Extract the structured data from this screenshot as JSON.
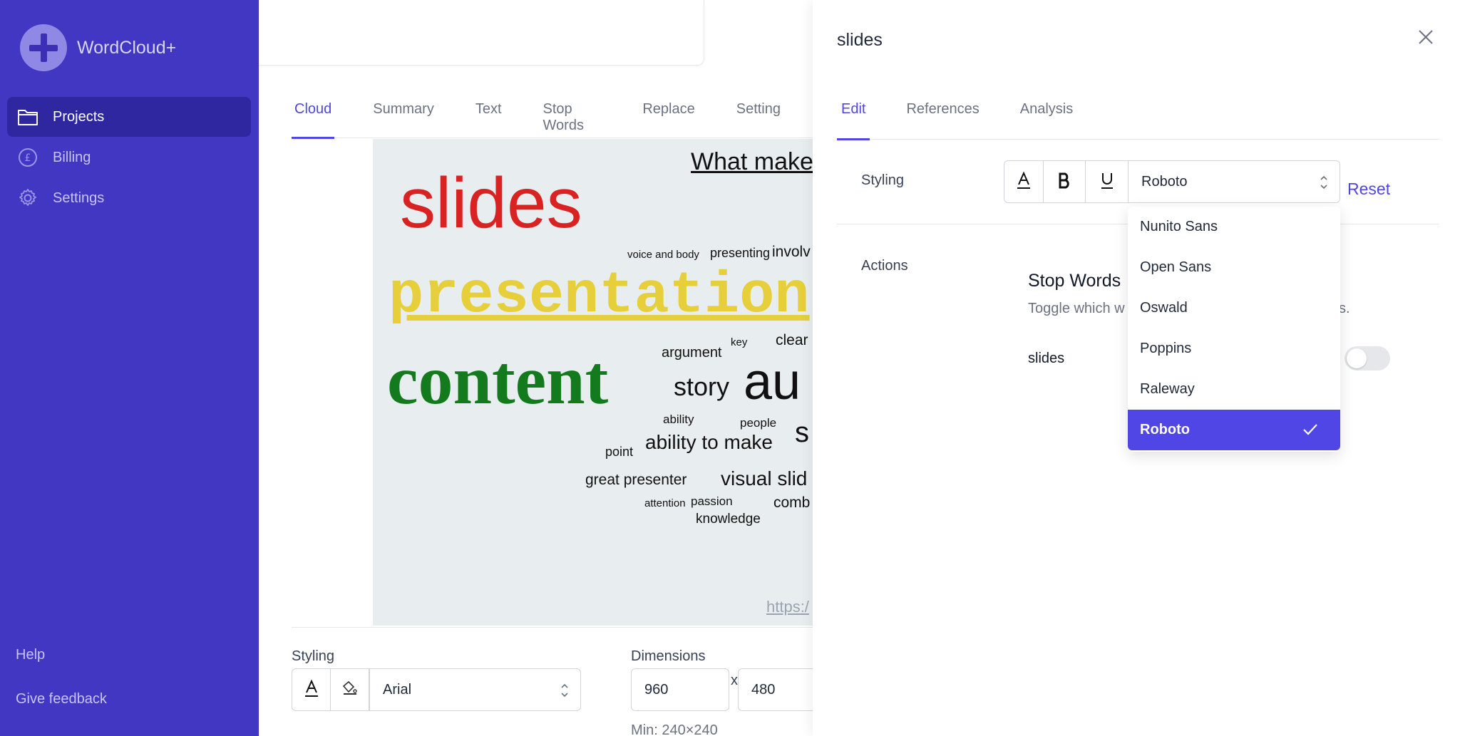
{
  "app": {
    "name": "WordCloud+"
  },
  "sidebar": {
    "items": [
      {
        "label": "Projects",
        "icon": "folder-icon",
        "active": true
      },
      {
        "label": "Billing",
        "icon": "pound-coin-icon",
        "active": false
      },
      {
        "label": "Settings",
        "icon": "gear-icon",
        "active": false
      }
    ],
    "help": "Help",
    "feedback": "Give feedback"
  },
  "main": {
    "tabs": [
      "Cloud",
      "Summary",
      "Text",
      "Stop Words",
      "Replace",
      "Setting"
    ],
    "active_tab": "Cloud",
    "cloud_words": [
      {
        "text": "What make",
        "color": "#111111"
      },
      {
        "text": "slides",
        "color": "#d92323"
      },
      {
        "text": "voice and body",
        "color": "#111111"
      },
      {
        "text": "presenting",
        "color": "#111111"
      },
      {
        "text": "involv",
        "color": "#111111"
      },
      {
        "text": "presentation",
        "color": "#e6cf3a"
      },
      {
        "text": "argument",
        "color": "#111111"
      },
      {
        "text": "key",
        "color": "#111111"
      },
      {
        "text": "clear",
        "color": "#111111"
      },
      {
        "text": "content",
        "color": "#147a1e"
      },
      {
        "text": "story",
        "color": "#111111"
      },
      {
        "text": "au",
        "color": "#111111"
      },
      {
        "text": "ability",
        "color": "#111111"
      },
      {
        "text": "people",
        "color": "#111111"
      },
      {
        "text": "s",
        "color": "#111111"
      },
      {
        "text": "point",
        "color": "#111111"
      },
      {
        "text": "ability to make",
        "color": "#111111"
      },
      {
        "text": "great presenter",
        "color": "#111111"
      },
      {
        "text": "visual slid",
        "color": "#111111"
      },
      {
        "text": "attention",
        "color": "#111111"
      },
      {
        "text": "passion",
        "color": "#111111"
      },
      {
        "text": "comb",
        "color": "#111111"
      },
      {
        "text": "knowledge",
        "color": "#111111"
      },
      {
        "text": "https:/",
        "color": "#9ca3af"
      }
    ],
    "styling": {
      "label": "Styling",
      "font": "Arial"
    },
    "dimensions": {
      "label": "Dimensions",
      "width": "960",
      "height": "480",
      "separator": "x",
      "min": "Min: 240×240"
    }
  },
  "panel": {
    "title": "slides",
    "tabs": [
      "Edit",
      "References",
      "Analysis"
    ],
    "active_tab": "Edit",
    "styling_label": "Styling",
    "font_value": "Roboto",
    "reset": "Reset",
    "actions_label": "Actions",
    "stop_words_title": "Stop Words",
    "stop_words_desc_start": "Toggle which w",
    "stop_words_desc_end": "s.",
    "word_label": "slides",
    "toggle_on": false,
    "font_options": [
      "Nunito Sans",
      "Open Sans",
      "Oswald",
      "Poppins",
      "Raleway",
      "Roboto"
    ],
    "selected_font": "Roboto"
  },
  "colors": {
    "sidebar": "#4137c3",
    "accent": "#4f46e5"
  }
}
